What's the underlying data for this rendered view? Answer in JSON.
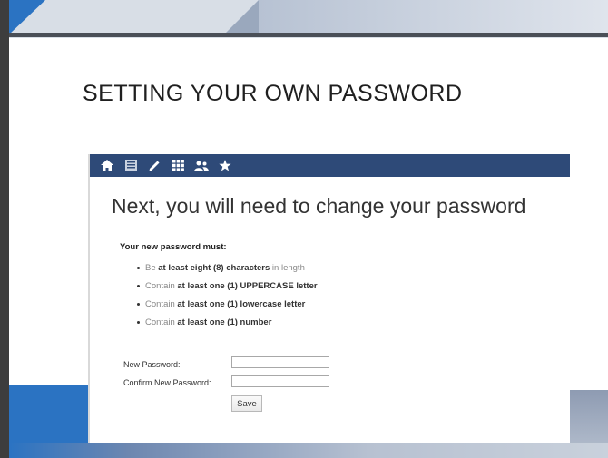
{
  "slide": {
    "title": "SETTING YOUR OWN PASSWORD"
  },
  "nav": {
    "icons": [
      "home-icon",
      "list-icon",
      "pencil-icon",
      "grid-icon",
      "people-icon",
      "star-icon"
    ]
  },
  "form": {
    "heading": "Next, you will need to change your password",
    "requirements_title": "Your new password must:",
    "rules": [
      {
        "pre": "Be ",
        "bold": "at least eight (8) characters",
        "post": " in length"
      },
      {
        "pre": "Contain ",
        "bold": "at least one (1) UPPERCASE letter",
        "post": ""
      },
      {
        "pre": "Contain ",
        "bold": "at least one (1) lowercase letter",
        "post": ""
      },
      {
        "pre": "Contain ",
        "bold": "at least one (1) number",
        "post": ""
      }
    ],
    "new_password_label": "New Password:",
    "new_password_value": "",
    "confirm_password_label": "Confirm New Password:",
    "confirm_password_value": "",
    "save_label": "Save"
  },
  "colors": {
    "nav_bar": "#2e4a78",
    "accent_blue": "#2b73c2"
  }
}
